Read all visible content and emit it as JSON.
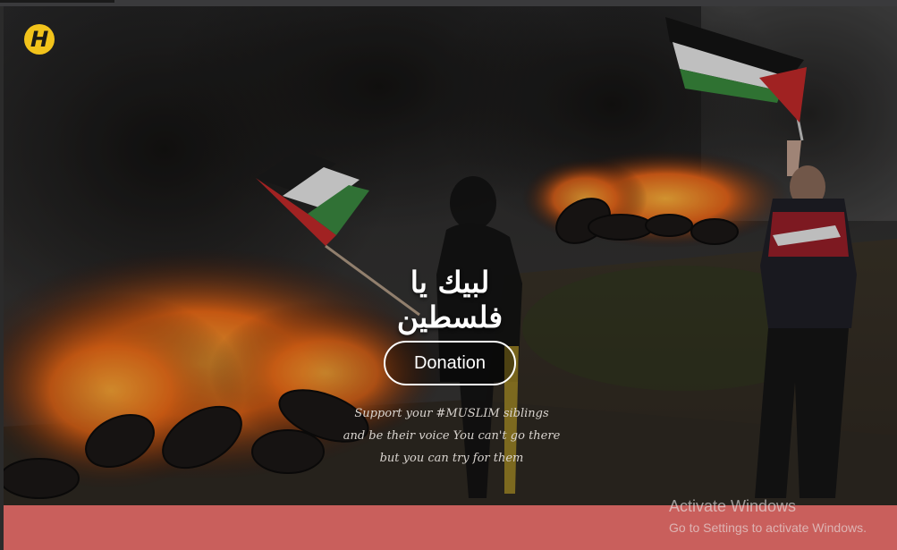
{
  "logo": {
    "glyph": "H",
    "color": "#f2c31b"
  },
  "hero": {
    "headline": "لبيك يا فلسطين",
    "donate_label": "Donation",
    "tagline_lines": [
      "Support your #MUSLIM siblings",
      "and be their voice You can't go there",
      "but you can try for them"
    ]
  },
  "footer": {
    "band_color": "#c95f5c"
  },
  "system_watermark": {
    "title": "Activate Windows",
    "subtitle": "Go to Settings to activate Windows."
  }
}
